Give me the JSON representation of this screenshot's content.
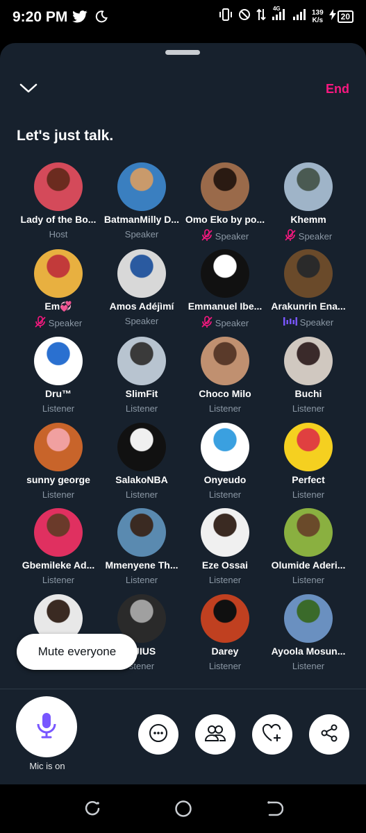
{
  "status_bar": {
    "time": "9:20 PM",
    "left_icons": [
      "twitter-icon",
      "do-not-disturb-moon-icon"
    ],
    "network_speed_value": "139",
    "network_speed_unit": "K/s",
    "network_type": "4G",
    "battery": "20"
  },
  "header": {
    "end_label": "End",
    "title": "Let's just talk."
  },
  "participants": [
    {
      "name": "Lady of the Bo...",
      "role": "Host",
      "role_icon": "",
      "colors": [
        "#d44a5a",
        "#6b2b1f"
      ]
    },
    {
      "name": "BatmanMilly D...",
      "role": "Speaker",
      "role_icon": "",
      "colors": [
        "#3a7fc0",
        "#c99a6b"
      ]
    },
    {
      "name": "Omo Eko by po...",
      "role": "Speaker",
      "role_icon": "muted-mic-icon",
      "colors": [
        "#9a6a4a",
        "#2a1a12"
      ]
    },
    {
      "name": "Khemm",
      "role": "Speaker",
      "role_icon": "muted-mic-icon",
      "colors": [
        "#9fb4c8",
        "#4a5a52"
      ]
    },
    {
      "name": "Em💞",
      "role": "Speaker",
      "role_icon": "muted-mic-icon",
      "colors": [
        "#e8b040",
        "#c23a3a"
      ]
    },
    {
      "name": "Amos Adéjìmí",
      "role": "Speaker",
      "role_icon": "",
      "colors": [
        "#d8d8d8",
        "#2a5aa0"
      ]
    },
    {
      "name": "Emmanuel Ibe...",
      "role": "Speaker",
      "role_icon": "muted-mic-icon",
      "colors": [
        "#111111",
        "#ffffff"
      ]
    },
    {
      "name": "Arakunrin Ena...",
      "role": "Speaker",
      "role_icon": "speaking-bars-icon",
      "colors": [
        "#6a4a2a",
        "#2a2a2a"
      ]
    },
    {
      "name": "Dru™",
      "role": "Listener",
      "role_icon": "",
      "colors": [
        "#ffffff",
        "#2a70d0"
      ]
    },
    {
      "name": "SlimFit",
      "role": "Listener",
      "role_icon": "",
      "colors": [
        "#b8c4d0",
        "#3a3a3a"
      ]
    },
    {
      "name": "Choco Milo",
      "role": "Listener",
      "role_icon": "",
      "colors": [
        "#c09070",
        "#5a3a2a"
      ]
    },
    {
      "name": "Buchi",
      "role": "Listener",
      "role_icon": "",
      "colors": [
        "#d0c8c0",
        "#3a2a2a"
      ]
    },
    {
      "name": "sunny george",
      "role": "Listener",
      "role_icon": "",
      "colors": [
        "#c8642a",
        "#f0a0a0"
      ]
    },
    {
      "name": "SalakoNBA",
      "role": "Listener",
      "role_icon": "",
      "colors": [
        "#111111",
        "#f0f0f0"
      ]
    },
    {
      "name": "Onyeudo",
      "role": "Listener",
      "role_icon": "",
      "colors": [
        "#ffffff",
        "#3aa0e0"
      ]
    },
    {
      "name": "Perfect",
      "role": "Listener",
      "role_icon": "",
      "colors": [
        "#f5d020",
        "#e04040"
      ]
    },
    {
      "name": "Gbemileke Ad...",
      "role": "Listener",
      "role_icon": "",
      "colors": [
        "#e03060",
        "#6a3a2a"
      ]
    },
    {
      "name": "Mmenyene Th...",
      "role": "Listener",
      "role_icon": "",
      "colors": [
        "#5a8ab0",
        "#3a2a22"
      ]
    },
    {
      "name": "Eze Ossai",
      "role": "Listener",
      "role_icon": "",
      "colors": [
        "#f0f0f0",
        "#3a2a22"
      ]
    },
    {
      "name": "Olumide Aderi...",
      "role": "Listener",
      "role_icon": "",
      "colors": [
        "#8ab040",
        "#6a4a2a"
      ]
    },
    {
      "name": "",
      "role": "",
      "role_icon": "",
      "colors": [
        "#e8e8e8",
        "#3a2a22"
      ]
    },
    {
      "name": "YJIUS",
      "role": "stener",
      "role_icon": "",
      "colors": [
        "#2a2a2a",
        "#a0a0a0"
      ]
    },
    {
      "name": "Darey",
      "role": "Listener",
      "role_icon": "",
      "colors": [
        "#c04020",
        "#101010"
      ]
    },
    {
      "name": "Ayoola Mosun...",
      "role": "Listener",
      "role_icon": "",
      "colors": [
        "#6a90c0",
        "#3a6a2a"
      ]
    }
  ],
  "controls": {
    "mute_everyone_label": "Mute everyone",
    "mic_label": "Mic is on"
  },
  "colors": {
    "background": "#17212d",
    "accent_end": "#f91880",
    "accent_mic": "#7856ff",
    "muted_text": "#8b98a5"
  }
}
